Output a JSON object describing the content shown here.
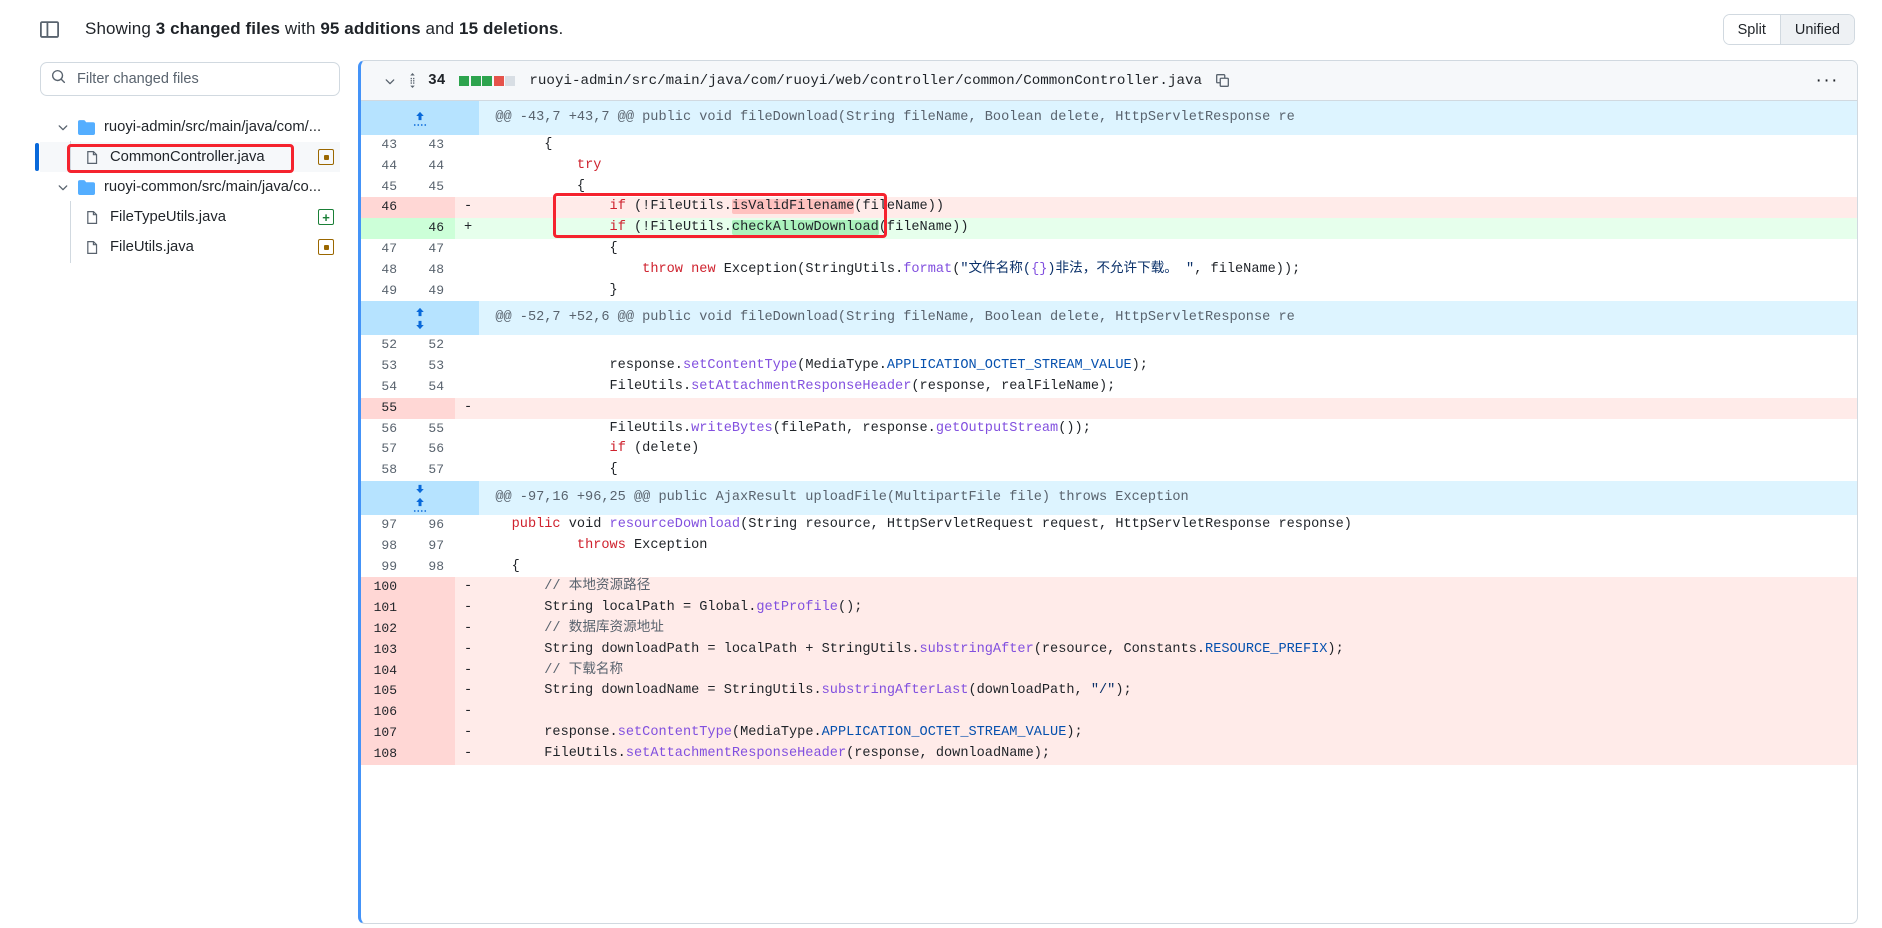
{
  "header": {
    "sidebar_toggle_icon": "sidebar-expand-icon",
    "summary_prefix": "Showing ",
    "changed_files": "3 changed files",
    "with_text": " with ",
    "additions": "95 additions",
    "and_text": " and ",
    "deletions": "15 deletions",
    "period": ".",
    "view_split_label": "Split",
    "view_unified_label": "Unified",
    "active_view": "Unified"
  },
  "filetree": {
    "search_placeholder": "Filter changed files",
    "search_value": "",
    "search_icon": "search-icon",
    "items": [
      {
        "type": "folder",
        "label": "ruoyi-admin/src/main/java/com/...",
        "icon": "folder-icon",
        "chevron": "chevron-down-icon",
        "status": ""
      },
      {
        "type": "file",
        "label": "CommonController.java",
        "icon": "file-icon",
        "status": "modified",
        "selected": true,
        "annotated": true
      },
      {
        "type": "folder",
        "label": "ruoyi-common/src/main/java/co...",
        "icon": "folder-icon",
        "chevron": "chevron-down-icon",
        "status": ""
      },
      {
        "type": "file",
        "label": "FileTypeUtils.java",
        "icon": "file-icon",
        "status": "added",
        "selected": false,
        "annotated": false
      },
      {
        "type": "file",
        "label": "FileUtils.java",
        "icon": "file-icon",
        "status": "modified",
        "selected": false,
        "annotated": false
      }
    ]
  },
  "diff": {
    "chevron": "chevron-down-icon",
    "drag_icon": "drag-handle-icon",
    "change_count": "34",
    "blocks": [
      "add",
      "add",
      "add",
      "del",
      "non"
    ],
    "filename": "ruoyi-admin/src/main/java/com/ruoyi/web/controller/common/CommonController.java",
    "copy_icon": "copy-icon",
    "kebab_icon": "kebab-menu-icon",
    "rows": [
      {
        "kind": "hunk",
        "expand": "up",
        "text": "@@ -43,7 +43,7 @@ public void fileDownload(String fileName, Boolean delete, HttpServletResponse re"
      },
      {
        "kind": "ctx",
        "old": "43",
        "new": "43",
        "marker": "",
        "html": "        {"
      },
      {
        "kind": "ctx",
        "old": "44",
        "new": "44",
        "marker": "",
        "html": "            <span class=\"tok-kw\">try</span>"
      },
      {
        "kind": "ctx",
        "old": "45",
        "new": "45",
        "marker": "",
        "html": "            {"
      },
      {
        "kind": "del",
        "old": "46",
        "new": "",
        "marker": "-",
        "html": "                <span class=\"tok-kw\">if</span> (!FileUtils.<span class=\"wdel\">isValidFilename</span>(fileName))",
        "annotated": true
      },
      {
        "kind": "add",
        "old": "",
        "new": "46",
        "marker": "+",
        "html": "                <span class=\"tok-kw\">if</span> (!FileUtils.<span class=\"wadd\">checkAllowDownload</span>(fileName))",
        "annotated": true
      },
      {
        "kind": "ctx",
        "old": "47",
        "new": "47",
        "marker": "",
        "html": "                {"
      },
      {
        "kind": "ctx",
        "old": "48",
        "new": "48",
        "marker": "",
        "html": "                    <span class=\"tok-kw\">throw</span> <span class=\"tok-kw\">new</span> Exception(StringUtils.<span class=\"tok-fn\">format</span>(<span class=\"tok-str\">\"文件名称(<span class=\"tok-fn\">{}</span>)非法，不允许下载。 \"</span>, fileName));"
      },
      {
        "kind": "ctx",
        "old": "49",
        "new": "49",
        "marker": "",
        "html": "                }"
      },
      {
        "kind": "hunk",
        "expand": "updown",
        "text": "@@ -52,7 +52,6 @@ public void fileDownload(String fileName, Boolean delete, HttpServletResponse re"
      },
      {
        "kind": "ctx",
        "old": "52",
        "new": "52",
        "marker": "",
        "html": ""
      },
      {
        "kind": "ctx",
        "old": "53",
        "new": "53",
        "marker": "",
        "html": "                response.<span class=\"tok-fn\">setContentType</span>(MediaType.<span class=\"tok-const\">APPLICATION_OCTET_STREAM_VALUE</span>);"
      },
      {
        "kind": "ctx",
        "old": "54",
        "new": "54",
        "marker": "",
        "html": "                FileUtils.<span class=\"tok-fn\">setAttachmentResponseHeader</span>(response, realFileName);"
      },
      {
        "kind": "del",
        "old": "55",
        "new": "",
        "marker": "-",
        "html": ""
      },
      {
        "kind": "ctx",
        "old": "56",
        "new": "55",
        "marker": "",
        "html": "                FileUtils.<span class=\"tok-fn\">writeBytes</span>(filePath, response.<span class=\"tok-fn\">getOutputStream</span>());"
      },
      {
        "kind": "ctx",
        "old": "57",
        "new": "56",
        "marker": "",
        "html": "                <span class=\"tok-kw\">if</span> (delete)"
      },
      {
        "kind": "ctx",
        "old": "58",
        "new": "57",
        "marker": "",
        "html": "                {"
      },
      {
        "kind": "hunk",
        "expand": "downup",
        "text": "@@ -97,16 +96,25 @@ public AjaxResult uploadFile(MultipartFile file) throws Exception"
      },
      {
        "kind": "ctx",
        "old": "97",
        "new": "96",
        "marker": "",
        "html": "    <span class=\"tok-kw\">public</span> void <span class=\"tok-fn\">resourceDownload</span>(String resource, HttpServletRequest request, HttpServletResponse response)"
      },
      {
        "kind": "ctx",
        "old": "98",
        "new": "97",
        "marker": "",
        "html": "            <span class=\"tok-kw\">throws</span> Exception"
      },
      {
        "kind": "ctx",
        "old": "99",
        "new": "98",
        "marker": "",
        "html": "    {"
      },
      {
        "kind": "del",
        "old": "100",
        "new": "",
        "marker": "-",
        "html": "        <span class=\"tok-cmt\">// 本地资源路径</span>"
      },
      {
        "kind": "del",
        "old": "101",
        "new": "",
        "marker": "-",
        "html": "        String localPath = Global.<span class=\"tok-fn\">getProfile</span>();"
      },
      {
        "kind": "del",
        "old": "102",
        "new": "",
        "marker": "-",
        "html": "        <span class=\"tok-cmt\">// 数据库资源地址</span>"
      },
      {
        "kind": "del",
        "old": "103",
        "new": "",
        "marker": "-",
        "html": "        String downloadPath = localPath + StringUtils.<span class=\"tok-fn\">substringAfter</span>(resource, Constants.<span class=\"tok-const\">RESOURCE_PREFIX</span>);"
      },
      {
        "kind": "del",
        "old": "104",
        "new": "",
        "marker": "-",
        "html": "        <span class=\"tok-cmt\">// 下载名称</span>"
      },
      {
        "kind": "del",
        "old": "105",
        "new": "",
        "marker": "-",
        "html": "        String downloadName = StringUtils.<span class=\"tok-fn\">substringAfterLast</span>(downloadPath, <span class=\"tok-str\">\"/\"</span>);"
      },
      {
        "kind": "del",
        "old": "106",
        "new": "",
        "marker": "-",
        "html": ""
      },
      {
        "kind": "del",
        "old": "107",
        "new": "",
        "marker": "-",
        "html": "        response.<span class=\"tok-fn\">setContentType</span>(MediaType.<span class=\"tok-const\">APPLICATION_OCTET_STREAM_VALUE</span>);"
      },
      {
        "kind": "del",
        "old": "108",
        "new": "",
        "marker": "-",
        "html": "        FileUtils.<span class=\"tok-fn\">setAttachmentResponseHeader</span>(response, downloadName);"
      }
    ]
  },
  "colors": {
    "accent": "#0969da",
    "annotation": "#f5232e",
    "add_bg": "#e6ffec",
    "del_bg": "#ffebe9",
    "hunk_bg": "#ddf4ff"
  }
}
